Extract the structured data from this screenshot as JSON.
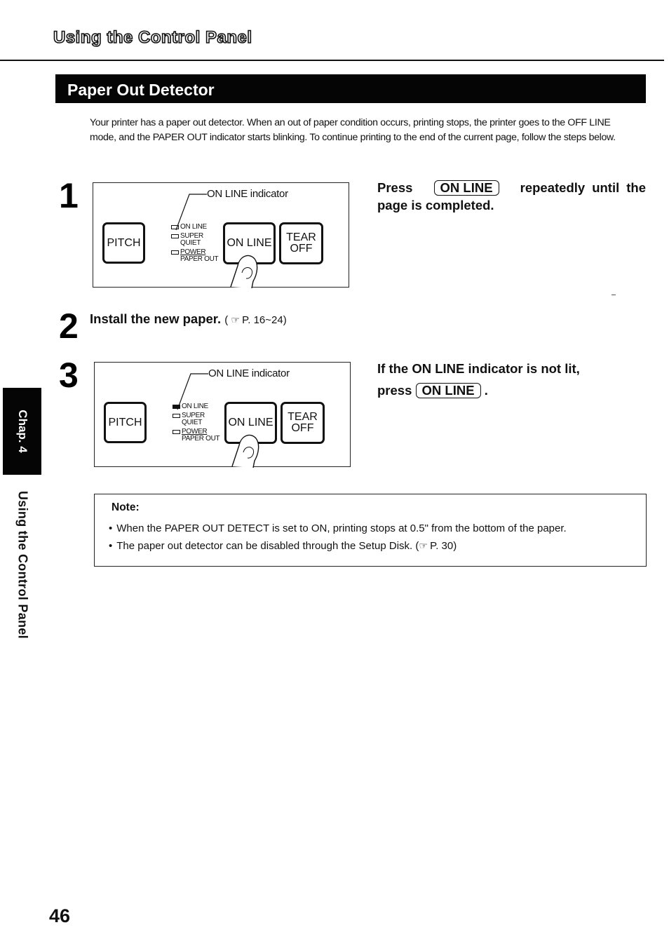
{
  "header": {
    "chapter_title": "Using the Control Panel"
  },
  "section": {
    "title": "Paper Out Detector"
  },
  "intro": "Your printer has a paper out detector. When an out of paper condition occurs, printing stops, the printer goes to the OFF LINE mode, and the PAPER OUT indicator starts blinking. To continue printing to the end of the current page, follow the steps below.",
  "steps": [
    {
      "number": "1",
      "panel": {
        "indicator_label": "ON LINE indicator",
        "buttons": {
          "pitch": "PITCH",
          "online": "ON LINE",
          "tear_line1": "TEAR",
          "tear_line2": "OFF"
        },
        "leds": [
          {
            "label": "ON LINE",
            "lit": false
          },
          {
            "label_line1": "SUPER",
            "label_line2": "QUIET",
            "lit": false
          },
          {
            "label_line1": "POWER",
            "label_line2": "PAPER OUT",
            "lit": false
          }
        ]
      },
      "instruction": {
        "prefix": "Press",
        "key": "ON LINE",
        "suffix": "repeatedly until the page is completed."
      }
    },
    {
      "number": "2",
      "instruction": "Install the new paper.",
      "reference": {
        "open": "(",
        "icon": "pointing-hand",
        "page": "P. 16~24)"
      }
    },
    {
      "number": "3",
      "panel": {
        "indicator_label": "ON LINE indicator",
        "buttons": {
          "pitch": "PITCH",
          "online": "ON LINE",
          "tear_line1": "TEAR",
          "tear_line2": "OFF"
        },
        "leds": [
          {
            "label": "ON LINE",
            "lit": true
          },
          {
            "label_line1": "SUPER",
            "label_line2": "QUIET",
            "lit": false
          },
          {
            "label_line1": "POWER",
            "label_line2": "PAPER OUT",
            "lit": false
          }
        ]
      },
      "instruction": {
        "line1": "If the ON LINE indicator is not lit,",
        "prefix": "press",
        "key": "ON LINE",
        "suffix": "."
      }
    }
  ],
  "note": {
    "title": "Note:",
    "items": [
      "When the PAPER OUT DETECT is set to ON, printing stops at 0.5\" from the bottom of the paper.",
      "The paper out detector can be disabled through the Setup Disk."
    ],
    "item2_reference": {
      "open": "(",
      "page": "P. 30)"
    }
  },
  "sidebar": {
    "chapter_tab": "Chap. 4",
    "chapter_name": "Using the Control Panel"
  },
  "footer": {
    "page_number": "46"
  }
}
